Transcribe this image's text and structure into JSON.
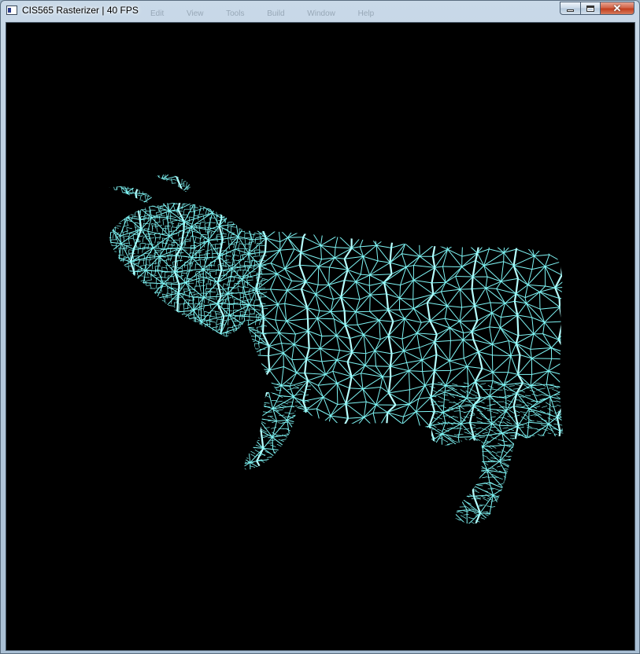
{
  "window": {
    "title": "CIS565 Rasterizer | 40 FPS",
    "ghost_menu": [
      "Edit",
      "View",
      "Tools",
      "Build",
      "Window",
      "Help"
    ]
  },
  "caption_buttons": {
    "minimize_icon": "minimize-icon",
    "maximize_icon": "maximize-icon",
    "close_icon": "close-icon",
    "close_glyph": "✕"
  },
  "render": {
    "background_color": "#000000",
    "wire_color": "#7ff5f5",
    "bright_wire_color": "#b8ffff",
    "model": "cow wireframe mesh"
  }
}
